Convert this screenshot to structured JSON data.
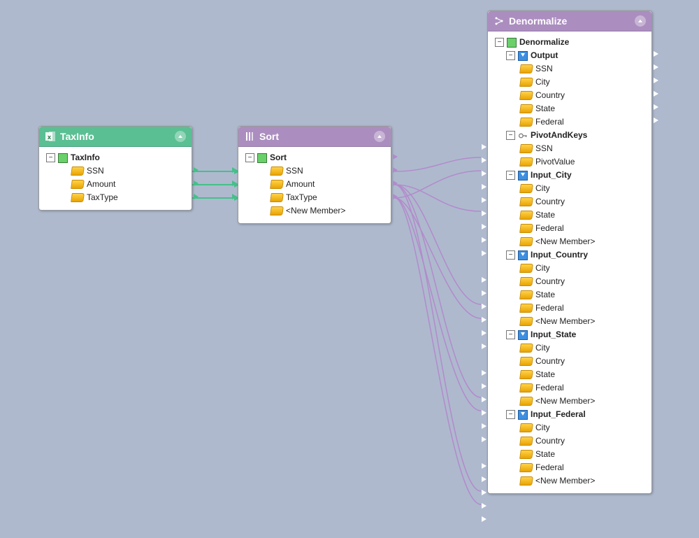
{
  "nodes": {
    "taxinfo": {
      "title": "TaxInfo",
      "root": "TaxInfo",
      "fields": [
        "SSN",
        "Amount",
        "TaxType"
      ]
    },
    "sort": {
      "title": "Sort",
      "root": "Sort",
      "fields": [
        "SSN",
        "Amount",
        "TaxType",
        "<New Member>"
      ]
    },
    "denorm": {
      "title": "Denormalize",
      "root": "Denormalize",
      "output": {
        "name": "Output",
        "fields": [
          "SSN",
          "City",
          "Country",
          "State",
          "Federal"
        ]
      },
      "pivot": {
        "name": "PivotAndKeys",
        "fields": [
          "SSN",
          "PivotValue"
        ]
      },
      "inputs": [
        {
          "name": "Input_City",
          "fields": [
            "City",
            "Country",
            "State",
            "Federal",
            "<New Member>"
          ]
        },
        {
          "name": "Input_Country",
          "fields": [
            "City",
            "Country",
            "State",
            "Federal",
            "<New Member>"
          ]
        },
        {
          "name": "Input_State",
          "fields": [
            "City",
            "Country",
            "State",
            "Federal",
            "<New Member>"
          ]
        },
        {
          "name": "Input_Federal",
          "fields": [
            "City",
            "Country",
            "State",
            "Federal",
            "<New Member>"
          ]
        }
      ]
    }
  },
  "colors": {
    "nodeGreen": "#5abf93",
    "nodePurple": "#ab8ebf",
    "wireGreen": "#45c08a",
    "wirePurple": "#b38acb",
    "bg": "#aeb9ce"
  }
}
